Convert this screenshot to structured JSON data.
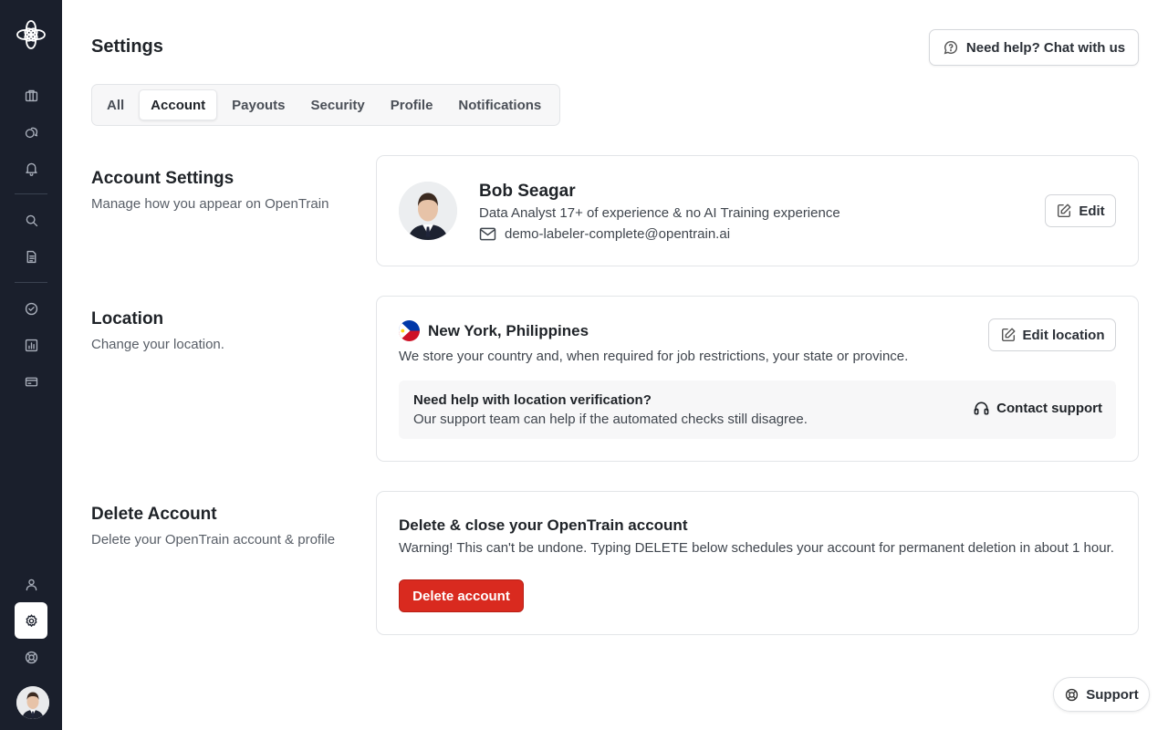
{
  "app": {
    "name": "OpenTrain"
  },
  "sidebar": {
    "logo_icon": "flower-logo-icon",
    "items": [
      {
        "name": "briefcase-icon"
      },
      {
        "name": "chat-bubbles-icon"
      },
      {
        "name": "bell-icon"
      },
      {
        "name": "search-icon"
      },
      {
        "name": "document-icon"
      },
      {
        "name": "check-circle-icon"
      },
      {
        "name": "bar-chart-icon"
      },
      {
        "name": "credit-card-icon"
      },
      {
        "name": "user-icon"
      },
      {
        "name": "gear-icon",
        "active": true
      },
      {
        "name": "lifebuoy-icon"
      }
    ]
  },
  "header": {
    "title": "Settings",
    "help_label": "Need help? Chat with us"
  },
  "tabs": [
    {
      "label": "All"
    },
    {
      "label": "Account",
      "active": true
    },
    {
      "label": "Payouts"
    },
    {
      "label": "Security"
    },
    {
      "label": "Profile"
    },
    {
      "label": "Notifications"
    }
  ],
  "account": {
    "section_title": "Account Settings",
    "section_desc": "Manage how you appear on OpenTrain",
    "name": "Bob Seagar",
    "role": "Data Analyst 17+ of experience & no AI Training experience",
    "email": "demo-labeler-complete@opentrain.ai",
    "edit_label": "Edit"
  },
  "location": {
    "section_title": "Location",
    "section_desc": "Change your location.",
    "place": "New York, Philippines",
    "desc": "We store your country and, when required for job restrictions, your state or province.",
    "edit_label": "Edit location",
    "help_title": "Need help with location verification?",
    "help_desc": "Our support team can help if the automated checks still disagree.",
    "contact_label": "Contact support"
  },
  "delete": {
    "section_title": "Delete Account",
    "section_desc": "Delete your OpenTrain account & profile",
    "card_title": "Delete & close your OpenTrain account",
    "card_desc": "Warning! This can't be undone. Typing DELETE below schedules your account for permanent deletion in about 1 hour.",
    "button_label": "Delete account"
  },
  "support": {
    "label": "Support"
  },
  "colors": {
    "sidebar": "#1a1f2c",
    "danger": "#d92a1f"
  }
}
